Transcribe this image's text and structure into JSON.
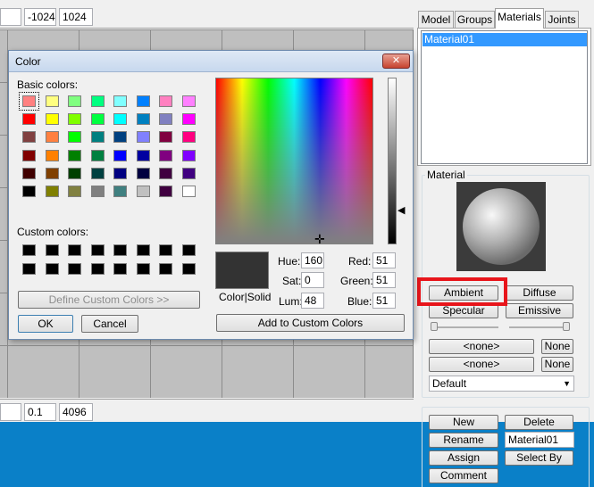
{
  "top_strip": {
    "field_a": "-1024",
    "field_b": "1024"
  },
  "bottom_strip": {
    "field_a": "0.1",
    "field_b": "4096"
  },
  "tabs": [
    {
      "label": "Model"
    },
    {
      "label": "Groups"
    },
    {
      "label": "Materials",
      "active": true
    },
    {
      "label": "Joints"
    }
  ],
  "materials": {
    "items": [
      "Material01"
    ],
    "selected": "Material01"
  },
  "material_group": {
    "label": "Material",
    "buttons": {
      "ambient": "Ambient",
      "diffuse": "Diffuse",
      "specular": "Specular",
      "emissive": "Emissive"
    },
    "texture1": {
      "value": "<none>",
      "clear": "None"
    },
    "texture2": {
      "value": "<none>",
      "clear": "None"
    },
    "blend_mode": "Default"
  },
  "actions": {
    "new": "New",
    "delete": "Delete",
    "rename": "Rename",
    "name_value": "Material01",
    "assign": "Assign",
    "select_by": "Select By",
    "comment": "Comment"
  },
  "color_dialog": {
    "title": "Color",
    "close": "✕",
    "basic_colors_label": "Basic colors:",
    "basic_colors": [
      "#ff8080",
      "#ffff80",
      "#80ff80",
      "#00ff80",
      "#80ffff",
      "#0080ff",
      "#ff80c0",
      "#ff80ff",
      "#ff0000",
      "#ffff00",
      "#80ff00",
      "#00ff40",
      "#00ffff",
      "#0080c0",
      "#8080c0",
      "#ff00ff",
      "#804040",
      "#ff8040",
      "#00ff00",
      "#008080",
      "#004080",
      "#8080ff",
      "#800040",
      "#ff0080",
      "#800000",
      "#ff8000",
      "#008000",
      "#008040",
      "#0000ff",
      "#0000a0",
      "#800080",
      "#8000ff",
      "#400000",
      "#804000",
      "#004000",
      "#004040",
      "#000080",
      "#000040",
      "#400040",
      "#400080",
      "#000000",
      "#808000",
      "#808040",
      "#808080",
      "#408080",
      "#c0c0c0",
      "#400040",
      "#ffffff"
    ],
    "custom_colors_label": "Custom colors:",
    "custom_colors": [
      "#000000",
      "#000000",
      "#000000",
      "#000000",
      "#000000",
      "#000000",
      "#000000",
      "#000000",
      "#000000",
      "#000000",
      "#000000",
      "#000000",
      "#000000",
      "#000000",
      "#000000",
      "#000000"
    ],
    "define_custom": "Define Custom Colors >>",
    "ok": "OK",
    "cancel": "Cancel",
    "color_solid_label": "Color|Solid",
    "current_color": "#333333",
    "hue_label": "Hue:",
    "hue": "160",
    "sat_label": "Sat:",
    "sat": "0",
    "lum_label": "Lum:",
    "lum": "48",
    "red_label": "Red:",
    "red": "51",
    "green_label": "Green:",
    "green": "51",
    "blue_label": "Blue:",
    "blue": "51",
    "add_custom": "Add to Custom Colors"
  },
  "colors": {
    "highlight": "#e8151b",
    "selection": "#3399ff",
    "desktop": "#0a80c8"
  }
}
